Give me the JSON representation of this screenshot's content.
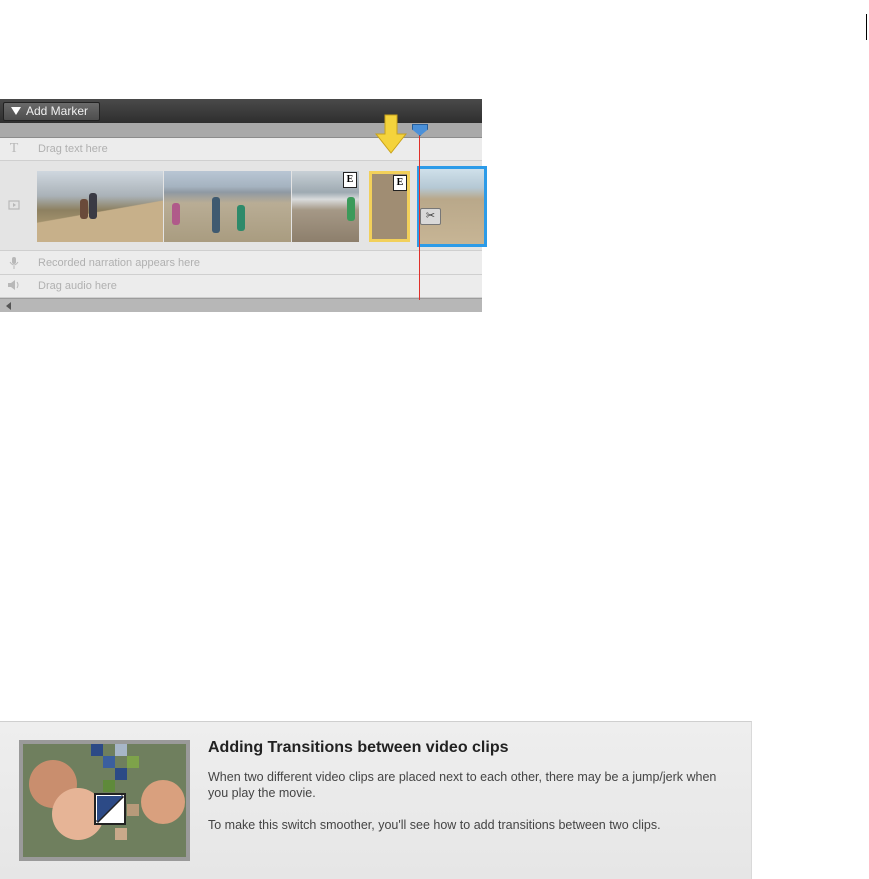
{
  "timeline": {
    "add_marker_label": "Add Marker",
    "tracks": {
      "text": "Drag text here",
      "narration": "Recorded narration appears here",
      "audio": "Drag audio here"
    },
    "effect_badge": "E"
  },
  "info": {
    "title": "Adding Transitions between video clips",
    "paragraph1": "When two different video clips are placed next to each other, there may be a jump/jerk when you play the movie.",
    "paragraph2": "To make this switch smoother, you'll see how to add transitions between two clips."
  },
  "colors": {
    "selected_clip_border": "#2c9be8",
    "drop_target_border": "#f2d05a",
    "playhead": "#e0302a",
    "drop_arrow": "#f4d33c"
  }
}
